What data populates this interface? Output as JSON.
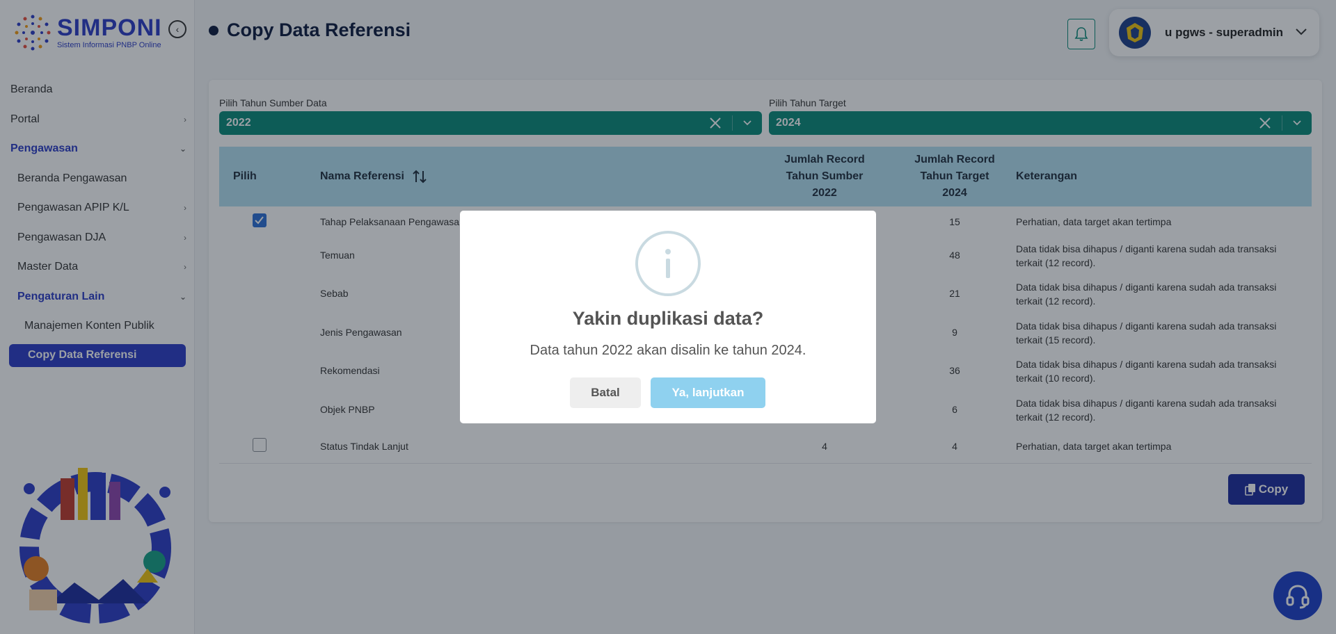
{
  "app": {
    "logo_title": "SIMPONI",
    "logo_subtitle": "Sistem Informasi PNBP Online"
  },
  "sidebar": {
    "items": [
      {
        "label": "Beranda"
      },
      {
        "label": "Portal"
      },
      {
        "label": "Pengawasan"
      },
      {
        "label": "Beranda Pengawasan"
      },
      {
        "label": "Pengawasan APIP K/L"
      },
      {
        "label": "Pengawasan DJA"
      },
      {
        "label": "Master Data"
      },
      {
        "label": "Pengaturan Lain"
      },
      {
        "label": "Manajemen Konten Publik"
      },
      {
        "label": "Copy Data Referensi"
      }
    ]
  },
  "header": {
    "title": "Copy Data Referensi",
    "user": "u pgws - superadmin"
  },
  "filters": {
    "source_label": "Pilih Tahun Sumber Data",
    "source_value": "2022",
    "target_label": "Pilih Tahun Target",
    "target_value": "2024"
  },
  "table": {
    "headers": {
      "pilih": "Pilih",
      "nama": "Nama Referensi",
      "src_l1": "Jumlah Record",
      "src_l2": "Tahun Sumber",
      "src_l3": "2022",
      "tgt_l1": "Jumlah Record",
      "tgt_l2": "Tahun Target",
      "tgt_l3": "2024",
      "ket": "Keterangan"
    },
    "rows": [
      {
        "nama": "Tahap Pelaksanaan Pengawasan",
        "src": "",
        "tgt": "15",
        "ket1": "Perhatian, data target akan tertimpa",
        "ket2": ""
      },
      {
        "nama": "Temuan",
        "src": "",
        "tgt": "48",
        "ket1": "Data tidak bisa dihapus / diganti karena sudah ada transaksi",
        "ket2": "terkait (12 record)."
      },
      {
        "nama": "Sebab",
        "src": "",
        "tgt": "21",
        "ket1": "Data tidak bisa dihapus / diganti karena sudah ada transaksi",
        "ket2": "terkait (12 record)."
      },
      {
        "nama": "Jenis Pengawasan",
        "src": "",
        "tgt": "9",
        "ket1": "Data tidak bisa dihapus / diganti karena sudah ada transaksi",
        "ket2": "terkait (15 record)."
      },
      {
        "nama": "Rekomendasi",
        "src": "",
        "tgt": "36",
        "ket1": "Data tidak bisa dihapus / diganti karena sudah ada transaksi",
        "ket2": "terkait (10 record)."
      },
      {
        "nama": "Objek PNBP",
        "src": "",
        "tgt": "6",
        "ket1": "Data tidak bisa dihapus / diganti karena sudah ada transaksi",
        "ket2": "terkait (12 record)."
      },
      {
        "nama": "Status Tindak Lanjut",
        "src": "4",
        "tgt": "4",
        "ket1": "Perhatian, data target akan tertimpa",
        "ket2": ""
      }
    ]
  },
  "actions": {
    "copy_label": "Copy"
  },
  "modal": {
    "title": "Yakin duplikasi data?",
    "text": "Data tahun 2022 akan disalin ke tahun 2024.",
    "cancel_label": "Batal",
    "confirm_label": "Ya, lanjutkan"
  },
  "colors": {
    "brand": "#2b3cc6",
    "select_bg": "#0a8a79",
    "table_head": "#b3e0f2",
    "confirm_btn": "#8fd1ef"
  }
}
